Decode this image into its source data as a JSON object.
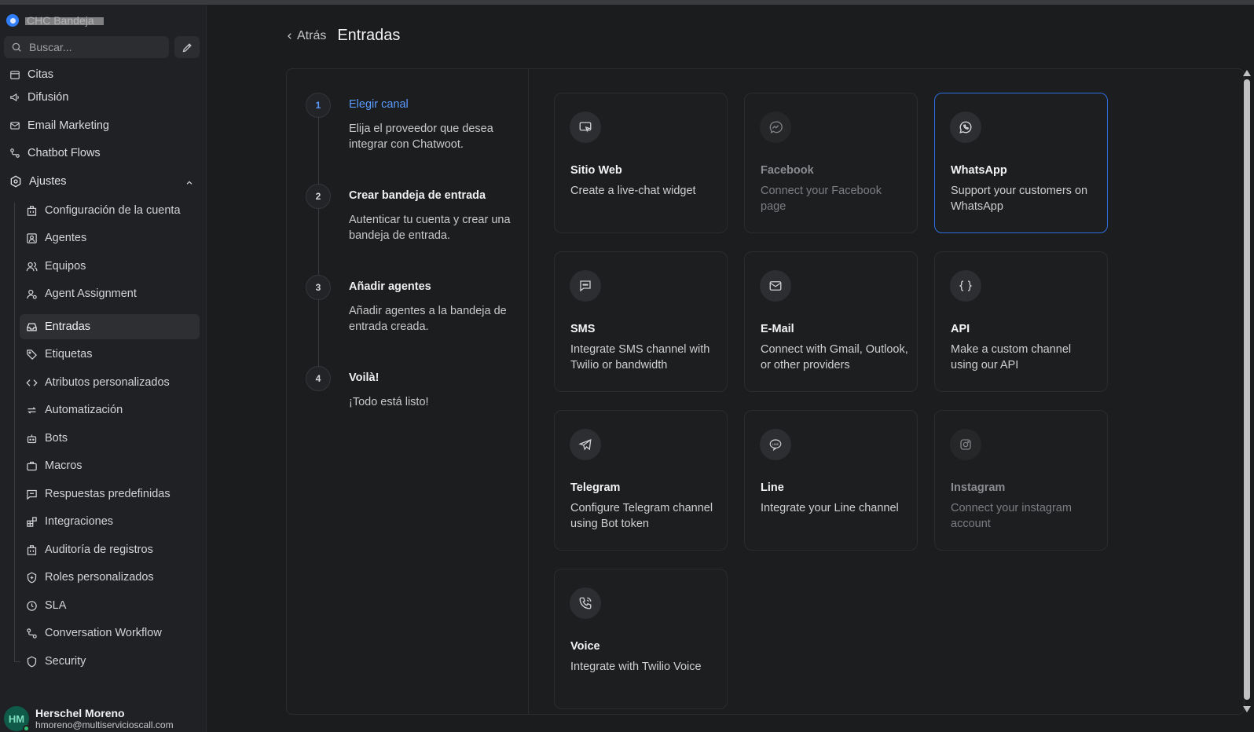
{
  "brand": {
    "name": "CHC Bandeja"
  },
  "search": {
    "placeholder": "Buscar..."
  },
  "nav": {
    "items": [
      {
        "label": "Citas"
      },
      {
        "label": "Difusión"
      },
      {
        "label": "Email Marketing"
      },
      {
        "label": "Chatbot Flows"
      }
    ],
    "settings": {
      "label": "Ajustes"
    },
    "sub_items": [
      {
        "label": "Configuración de la cuenta"
      },
      {
        "label": "Agentes"
      },
      {
        "label": "Equipos"
      },
      {
        "label": "Agent Assignment"
      },
      {
        "label": "Entradas",
        "active": true
      },
      {
        "label": "Etiquetas"
      },
      {
        "label": "Atributos personalizados"
      },
      {
        "label": "Automatización"
      },
      {
        "label": "Bots"
      },
      {
        "label": "Macros"
      },
      {
        "label": "Respuestas predefinidas"
      },
      {
        "label": "Integraciones"
      },
      {
        "label": "Auditoría de registros"
      },
      {
        "label": "Roles personalizados"
      },
      {
        "label": "SLA"
      },
      {
        "label": "Conversation Workflow"
      },
      {
        "label": "Security"
      }
    ]
  },
  "user": {
    "initials": "HM",
    "name": "Herschel Moreno",
    "email": "hmoreno@multiservicioscall.com"
  },
  "header": {
    "back_label": "Atrás",
    "title": "Entradas"
  },
  "steps": [
    {
      "number": "1",
      "title": "Elegir canal",
      "description": "Elija el proveedor que desea integrar con Chatwoot.",
      "active": true
    },
    {
      "number": "2",
      "title": "Crear bandeja de entrada",
      "description": "Autenticar tu cuenta y crear una bandeja de entrada."
    },
    {
      "number": "3",
      "title": "Añadir agentes",
      "description": "Añadir agentes a la bandeja de entrada creada."
    },
    {
      "number": "4",
      "title": "Voilà!",
      "description": "¡Todo está listo!"
    }
  ],
  "channels": [
    {
      "title": "Sitio Web",
      "description": "Create a live-chat widget",
      "icon": "website-icon"
    },
    {
      "title": "Facebook",
      "description": "Connect your Facebook page",
      "icon": "messenger-icon",
      "disabled": true
    },
    {
      "title": "WhatsApp",
      "description": "Support your customers on WhatsApp",
      "icon": "whatsapp-icon",
      "selected": true
    },
    {
      "title": "SMS",
      "description": "Integrate SMS channel with Twilio or bandwidth",
      "icon": "sms-icon"
    },
    {
      "title": "E-Mail",
      "description": "Connect with Gmail, Outlook, or other providers",
      "icon": "mail-icon"
    },
    {
      "title": "API",
      "description": "Make a custom channel using our API",
      "icon": "braces-icon"
    },
    {
      "title": "Telegram",
      "description": "Configure Telegram channel using Bot token",
      "icon": "telegram-icon"
    },
    {
      "title": "Line",
      "description": "Integrate your Line channel",
      "icon": "line-icon"
    },
    {
      "title": "Instagram",
      "description": "Connect your instagram account",
      "icon": "instagram-icon",
      "disabled": true
    },
    {
      "title": "Voice",
      "description": "Integrate with Twilio Voice",
      "icon": "phone-icon"
    }
  ],
  "colors": {
    "accent": "#5b9bff",
    "selected_border": "#2d6fe0",
    "background": "#1b1c1e",
    "sidebar": "#202124"
  }
}
